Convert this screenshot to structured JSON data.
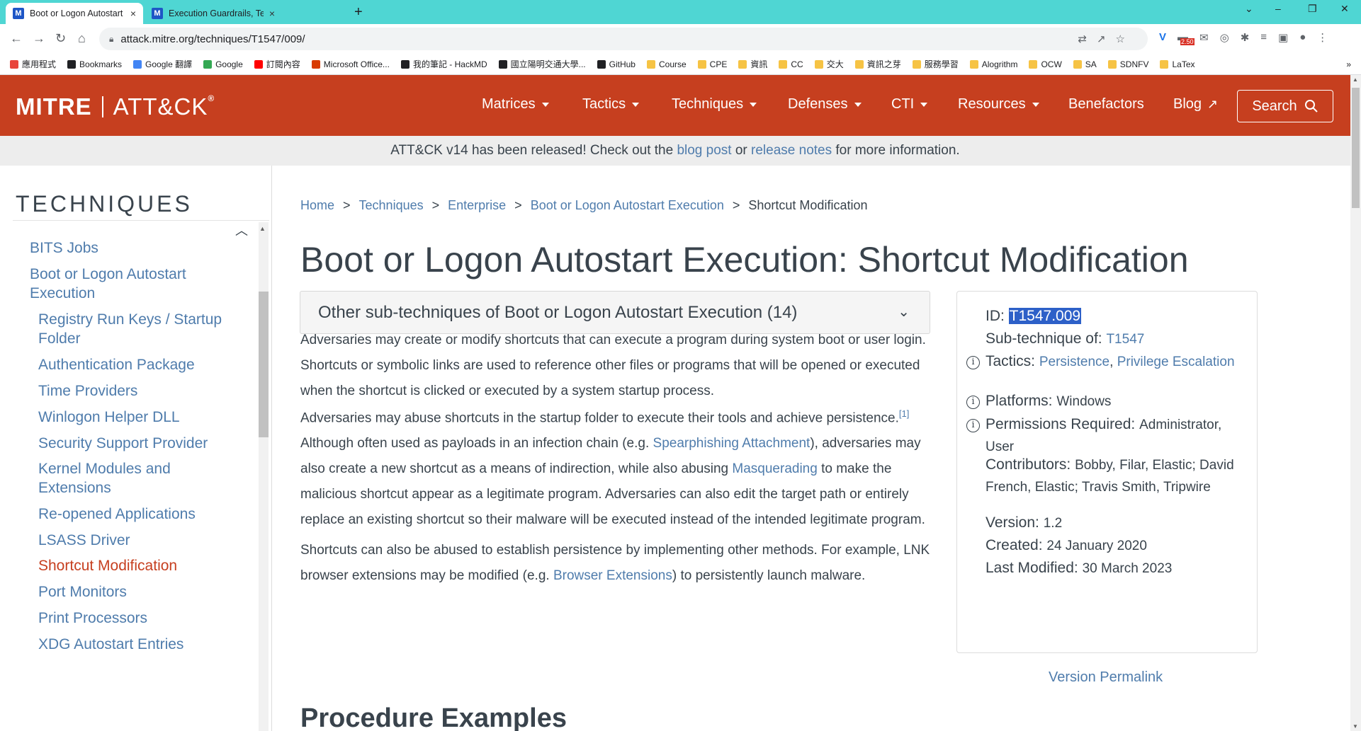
{
  "browser": {
    "tabs": [
      {
        "favicon": "M",
        "title": "Boot or Logon Autostart Execu",
        "close": "×"
      },
      {
        "favicon": "M",
        "title": "Execution Guardrails, Techniqu",
        "close": "×"
      }
    ],
    "new_tab": "+",
    "window_controls": {
      "tabsearch": "⌄",
      "minimize": "–",
      "restore": "❐",
      "close": "✕"
    },
    "nav": {
      "back": "←",
      "forward": "→",
      "reload": "↻",
      "home": "⌂"
    },
    "url": "attack.mitre.org/techniques/T1547/009/",
    "omnibox_icons": [
      "translate-icon",
      "share-icon",
      "star-icon"
    ],
    "extension_badge": "2.50",
    "bookmarks": [
      {
        "label": "應用程式",
        "icon_color": "#e8453c"
      },
      {
        "label": "Bookmarks",
        "icon_color": "#202124"
      },
      {
        "label": "Google 翻譯",
        "icon_color": "#4285f4"
      },
      {
        "label": "Google",
        "icon_color": "#34a853"
      },
      {
        "label": "訂閱內容",
        "icon_color": "#ff0000"
      },
      {
        "label": "Microsoft Office...",
        "icon_color": "#d83b01"
      },
      {
        "label": "我的筆記 - HackMD",
        "icon_color": "#202124"
      },
      {
        "label": "國立陽明交通大學...",
        "icon_color": "#202124"
      },
      {
        "label": "GitHub",
        "icon_color": "#202124"
      },
      {
        "label": "Course",
        "icon_color": "#f6c344"
      },
      {
        "label": "CPE",
        "icon_color": "#f6c344"
      },
      {
        "label": "資訊",
        "icon_color": "#f6c344"
      },
      {
        "label": "CC",
        "icon_color": "#f6c344"
      },
      {
        "label": "交大",
        "icon_color": "#f6c344"
      },
      {
        "label": "資訊之芽",
        "icon_color": "#f6c344"
      },
      {
        "label": "服務學習",
        "icon_color": "#f6c344"
      },
      {
        "label": "Alogrithm",
        "icon_color": "#f6c344"
      },
      {
        "label": "OCW",
        "icon_color": "#f6c344"
      },
      {
        "label": "SA",
        "icon_color": "#f6c344"
      },
      {
        "label": "SDNFV",
        "icon_color": "#f6c344"
      },
      {
        "label": "LaTex",
        "icon_color": "#f6c344"
      }
    ],
    "bookmarks_more": "»"
  },
  "header": {
    "logo_mitre": "MITRE",
    "logo_attck": "ATT&CK",
    "logo_reg": "®",
    "nav": [
      "Matrices",
      "Tactics",
      "Techniques",
      "Defenses",
      "CTI",
      "Resources",
      "Benefactors",
      "Blog"
    ],
    "search_label": "Search",
    "brand_color": "#c63f1f"
  },
  "banner": {
    "text_before": "ATT&CK v14 has been released! Check out the ",
    "link1": "blog post",
    "text_mid": " or ",
    "link2": "release notes",
    "text_after": " for more information."
  },
  "sidebar": {
    "title": "TECHNIQUES",
    "items": [
      {
        "label": "BITS Jobs",
        "level": 0
      },
      {
        "label": "Boot or Logon Autostart",
        "level": 0
      },
      {
        "label": "Execution",
        "level": 0
      },
      {
        "label": "Registry Run Keys / Startup",
        "level": 1
      },
      {
        "label": "Folder",
        "level": 1
      },
      {
        "label": "Authentication Package",
        "level": 1
      },
      {
        "label": "Time Providers",
        "level": 1
      },
      {
        "label": "Winlogon Helper DLL",
        "level": 1
      },
      {
        "label": "Security Support Provider",
        "level": 1
      },
      {
        "label": "Kernel Modules and",
        "level": 1
      },
      {
        "label": "Extensions",
        "level": 1
      },
      {
        "label": "Re-opened Applications",
        "level": 1
      },
      {
        "label": "LSASS Driver",
        "level": 1
      },
      {
        "label": "Shortcut Modification",
        "level": 1,
        "active": true
      },
      {
        "label": "Port Monitors",
        "level": 1
      },
      {
        "label": "Print Processors",
        "level": 1
      },
      {
        "label": "XDG Autostart Entries",
        "level": 1
      }
    ]
  },
  "breadcrumb": [
    "Home",
    "Techniques",
    "Enterprise",
    "Boot or Logon Autostart Execution",
    "Shortcut Modification"
  ],
  "breadcrumb_sep": ">",
  "title": "Boot or Logon Autostart Execution: Shortcut Modification",
  "subtechniques_label": "Other sub-techniques of Boot or Logon Autostart Execution (14)",
  "description": {
    "p1": "Adversaries may create or modify shortcuts that can execute a program during system boot or user login. Shortcuts or symbolic links are used to reference other files or programs that will be opened or executed when the shortcut is clicked or executed by a system startup process.",
    "p2_a": "Adversaries may abuse shortcuts in the startup folder to execute their tools and achieve persistence.",
    "p2_ref": "[1]",
    "p2_b": " Although often used as payloads in an infection chain (e.g. ",
    "p2_link1": "Spearphishing Attachment",
    "p2_c": "), adversaries may also create a new shortcut as a means of indirection, while also abusing ",
    "p2_link2": "Masquerading",
    "p2_d": " to make the malicious shortcut appear as a legitimate program. Adversaries can also edit the target path or entirely replace an existing shortcut so their malware will be executed instead of the intended legitimate program.",
    "p3_a": "Shortcuts can also be abused to establish persistence by implementing other methods. For example, LNK browser extensions may be modified (e.g. ",
    "p3_link": "Browser Extensions",
    "p3_b": ") to persistently launch malware."
  },
  "procedure_heading": "Procedure Examples",
  "info": {
    "id_label": "ID: ",
    "id": "T1547.009",
    "subtechnique_label": "Sub-technique of: ",
    "subtechnique_of": "T1547",
    "tactics_label": "Tactics: ",
    "tactic1": "Persistence",
    "tactic_sep": ", ",
    "tactic2": "Privilege Escalation",
    "platforms_label": "Platforms: ",
    "platforms": "Windows",
    "permissions_label": "Permissions Required: ",
    "permissions": "Administrator, User",
    "contributors_label": "Contributors: ",
    "contributors": "Bobby, Filar, Elastic; David French, Elastic; Travis Smith, Tripwire",
    "version_label": "Version: ",
    "version": "1.2",
    "created_label": "Created: ",
    "created": "24 January 2020",
    "modified_label": "Last Modified: ",
    "modified": "30 March 2023",
    "info_glyph": "i"
  },
  "permalink": "Version Permalink"
}
